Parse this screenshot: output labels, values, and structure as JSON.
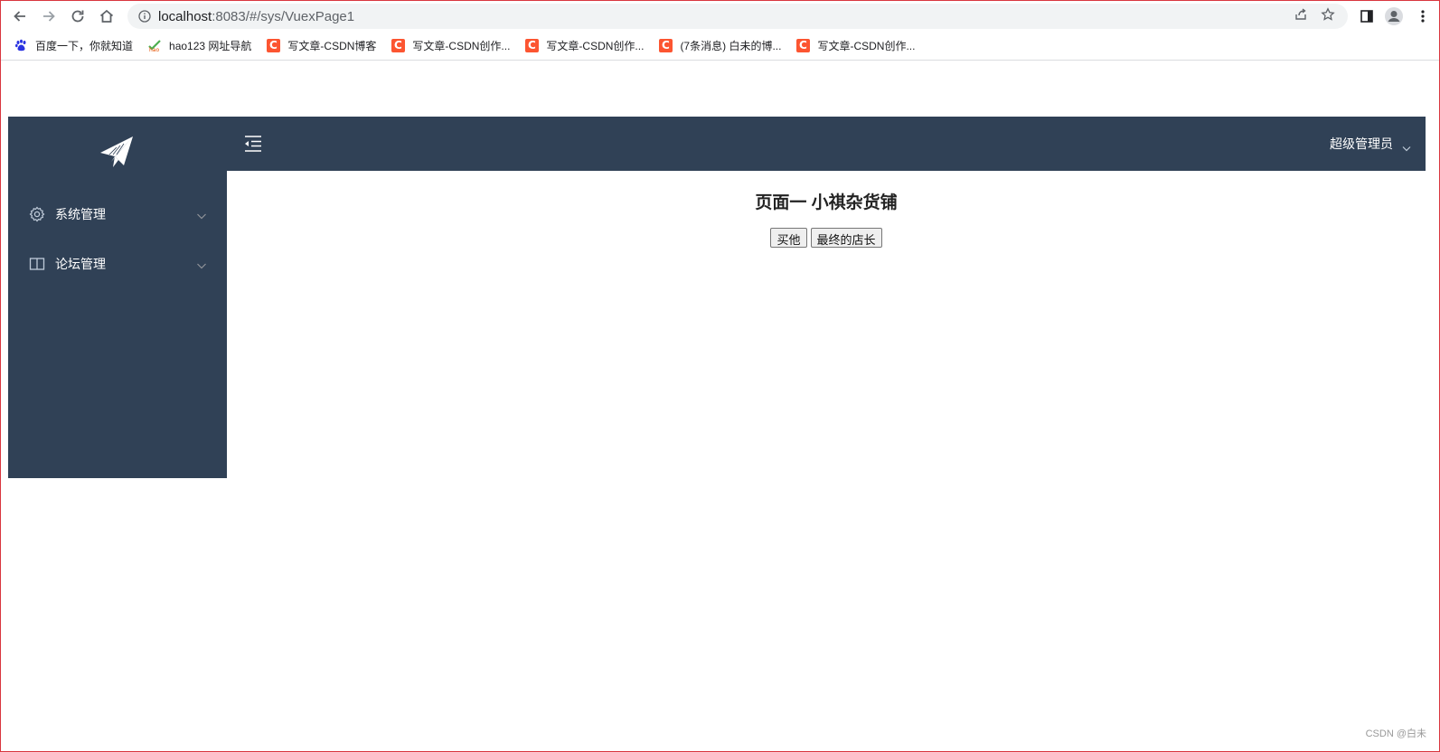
{
  "browser": {
    "url_host": "localhost",
    "url_path": ":8083/#/sys/VuexPage1"
  },
  "bookmarks": [
    {
      "label": "百度一下，你就知道",
      "icon": "baidu-paw-icon"
    },
    {
      "label": "hao123 网址导航",
      "icon": "hao123-icon"
    },
    {
      "label": "写文章-CSDN博客",
      "icon": "csdn-icon"
    },
    {
      "label": "写文章-CSDN创作...",
      "icon": "csdn-icon"
    },
    {
      "label": "写文章-CSDN创作...",
      "icon": "csdn-icon"
    },
    {
      "label": "(7条消息) 白未的博...",
      "icon": "csdn-icon"
    },
    {
      "label": "写文章-CSDN创作...",
      "icon": "csdn-icon"
    }
  ],
  "csdn_icon_letter": "C",
  "sidebar": {
    "logo_icon": "paper-plane-icon",
    "items": [
      {
        "label": "系统管理",
        "icon": "gear-icon"
      },
      {
        "label": "论坛管理",
        "icon": "book-icon"
      }
    ]
  },
  "header": {
    "user_name": "超级管理员"
  },
  "main": {
    "title": "页面一 小祺杂货铺",
    "buttons": [
      "买他",
      "最终的店长"
    ]
  },
  "watermark": "CSDN @白未",
  "colors": {
    "sidebar_bg": "#304156",
    "csdn_red": "#fc5531"
  }
}
